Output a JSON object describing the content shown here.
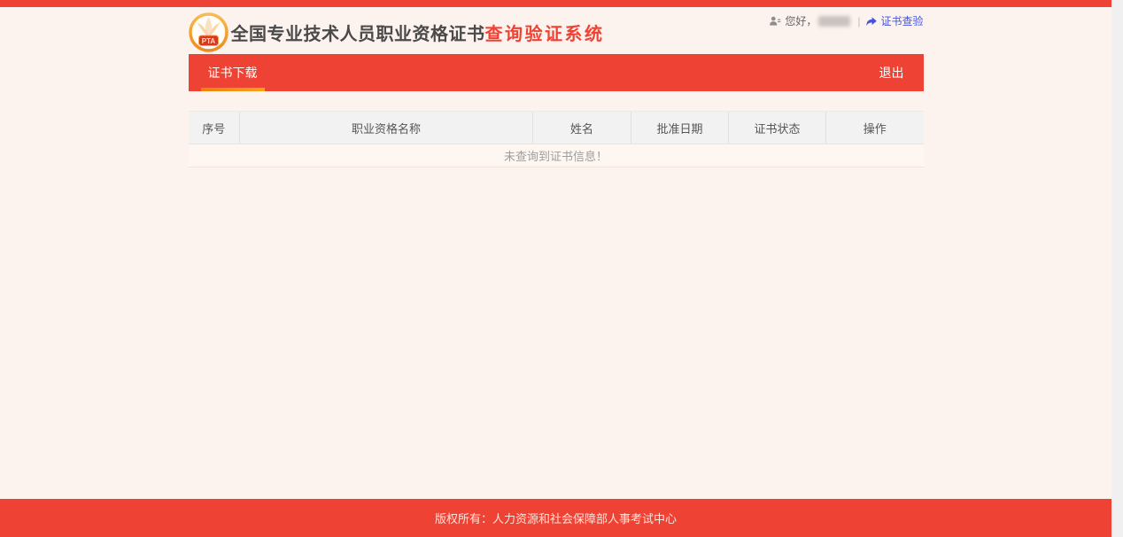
{
  "header": {
    "logo_text": "PTA",
    "title_main": "全国专业技术人员职业资格证书",
    "title_accent": "查询验证系统",
    "greeting": "您好，",
    "divider": "|",
    "verify_link_label": "证书查验"
  },
  "nav": {
    "tabs": [
      {
        "label": "证书下载",
        "active": true
      }
    ],
    "logout_label": "退出"
  },
  "table": {
    "columns": [
      "序号",
      "职业资格名称",
      "姓名",
      "批准日期",
      "证书状态",
      "操作"
    ],
    "rows": [],
    "empty_message": "未查询到证书信息！"
  },
  "footer": {
    "copyright": "版权所有：人力资源和社会保障部人事考试中心"
  },
  "colors": {
    "primary_red": "#ee4334",
    "tab_underline_orange": "#f28b0e",
    "link_blue": "#4153e3",
    "title_dark": "#4a4a4a",
    "page_background": "#fdf3ee",
    "table_header_bg": "#f3f2f2",
    "empty_text_gray": "#9d9d9d",
    "scroll_strip_gray": "#f0f0f1"
  },
  "icons": {
    "user_icon": "person-bust",
    "share_icon": "curved-share-arrow",
    "logo_icon": "pta-circular-badge"
  }
}
